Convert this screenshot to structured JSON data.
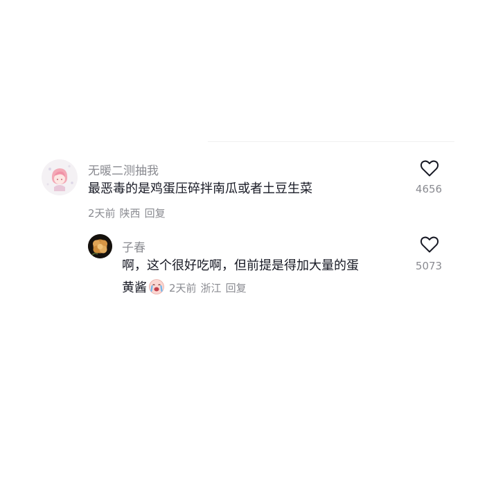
{
  "comments": [
    {
      "username": "无暖二测抽我",
      "text": "最恶毒的是鸡蛋压碎拌南瓜或者土豆生菜",
      "time": "2天前",
      "location": "陕西",
      "reply_label": "回复",
      "likes": "4656",
      "avatar_icon": "pink-anime-avatar"
    },
    {
      "username": "子春",
      "text_line1": "啊，这个很好吃啊，但前提是得加大量的蛋",
      "text_line2": "黄酱",
      "emoji": "crying-face-emoji",
      "time": "2天前",
      "location": "浙江",
      "reply_label": "回复",
      "likes": "5073",
      "avatar_icon": "flower-avatar"
    }
  ],
  "colors": {
    "primary_text": "#161823",
    "secondary_text": "#8a8b91"
  }
}
